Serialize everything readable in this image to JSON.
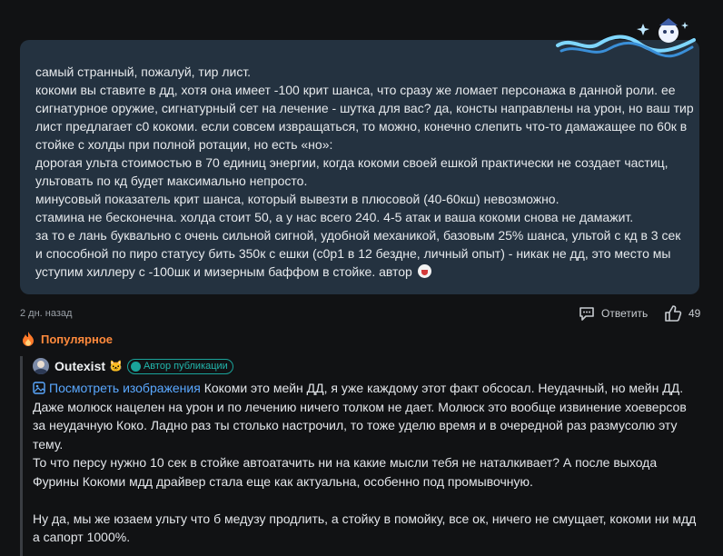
{
  "comment": {
    "lines": [
      "самый странный, пожалуй, тир лист.",
      "кокоми вы ставите в дд, хотя она имеет -100 крит шанса, что сразу же ломает персонажа в данной роли. ее",
      "сигнатурное оружие, сигнатурный сет на лечение - шутка для вас? да, консты направлены на урон, но ваш тир",
      "лист предлагает с0 кокоми. если совсем извращаться, то можно, конечно слепить что-то дамажащее по 60к в",
      "стойке с холды при полной ротации, но есть «но»:",
      "дорогая ульта стоимостью в 70 единиц энергии, когда кокоми своей ешкой практически не создает частиц,",
      "ультовать по кд будет максимально непросто.",
      "минусовый показатель крит шанса, который вывезти в плюсовой (40-60кш) невозможно.",
      "стамина не бесконечна. холда стоит 50, а у нас всего 240. 4-5 атак и ваша кокоми снова не дамажит.",
      "за то е лань буквально с очень сильной сигной, удобной механикой, базовым 25% шанса, ультой с кд в 3 сек",
      "и способной по пиро статусу бить 350к с ешки (с0р1 в 12 бездне, личный опыт) - никак не дд, это место мы",
      "уступим хиллеру с -100шк и мизерным баффом в стойке. автор"
    ],
    "time": "2 дн. назад",
    "reply_label": "Ответить",
    "likes": "49"
  },
  "popular": {
    "label": "Популярное",
    "icon": "fire-icon",
    "color": "#ff8a3c"
  },
  "reply": {
    "author": "Outexist",
    "author_emoji": "🐱",
    "badge": "Автор публикации",
    "view_image": "Посмотреть изображения",
    "first_line_rest": " Кокоми это мейн ДД, я уже каждому этот факт обсосал. Неудачный, но мейн ДД.",
    "lines": [
      "Даже молюск нацелен на урон и по лечению ничего толком не дает. Молюск это вообще извинение хоеверсов",
      "за неудачную Коко. Ладно раз ты столько настрочил, то тоже уделю время и в очередной раз размусолю эту",
      "тему.",
      "То что персу нужно 10 сек в стойке автоатачить ни на какие мысли тебя не наталкивает? А после выхода",
      "Фурины Кокоми мдд драйвер стала еще как актуальна, особенно под промывочную.",
      "",
      "Ну да, мы же юзаем ульту что б медузу продлить, а стойку в помойку, все ок, ничего не смущает, кокоми ни мдд",
      "а сапорт 1000%."
    ]
  },
  "colors": {
    "background": "#111214",
    "bubble": "#243240",
    "link": "#5aa8ff",
    "badge": "#1aa39a"
  }
}
